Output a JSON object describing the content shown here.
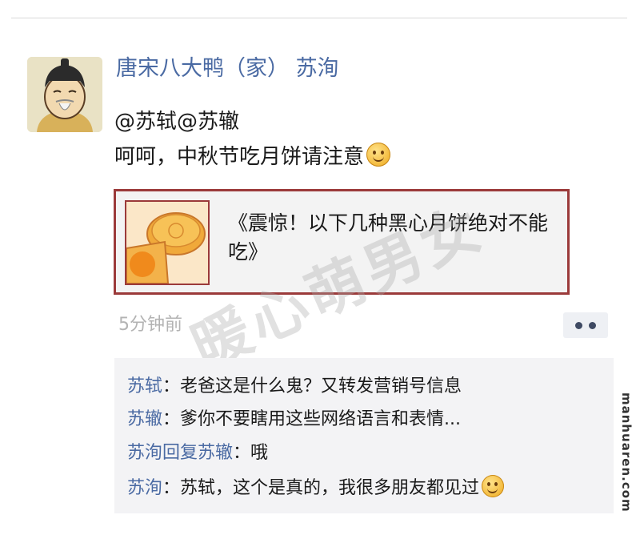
{
  "post": {
    "author": "唐宋八大鸭（家） 苏洵",
    "mention": "@苏轼@苏辙",
    "message": "呵呵，中秋节吃月饼请注意",
    "share_card": {
      "title": "《震惊！以下几种黑心月饼绝对不能吃》"
    },
    "timestamp": "5分钟前"
  },
  "comments": [
    {
      "name": "苏轼",
      "sep": "：",
      "text": "老爸这是什么鬼？又转发营销号信息"
    },
    {
      "name": "苏辙",
      "sep": "：",
      "text": "爹你不要瞎用这些网络语言和表情..."
    },
    {
      "name": "苏洵回复苏辙",
      "sep": "：",
      "text": "哦"
    },
    {
      "name": "苏洵",
      "sep": "：",
      "text": "苏轼，这个是真的，我很多朋友都见过"
    }
  ],
  "watermark": "暖心萌男女",
  "site_mark": "manhuaren.com",
  "icons": {
    "avatar": "old-man-avatar",
    "emoji": "smile-emoji-icon",
    "thumbnail": "mooncake-thumbnail",
    "more": "more-dots-icon"
  }
}
